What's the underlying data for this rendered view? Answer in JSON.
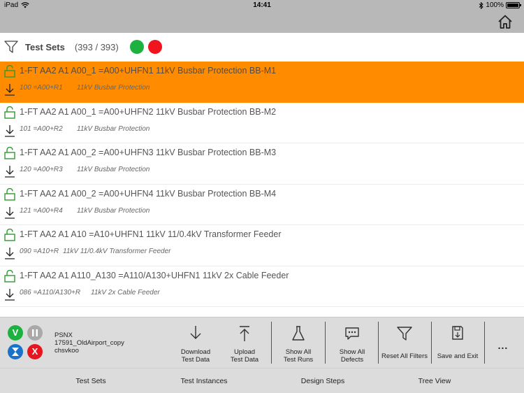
{
  "status_bar": {
    "device": "iPad",
    "time": "14:41",
    "battery": "100%"
  },
  "icons": {
    "wifi": "wifi-icon",
    "bluetooth": "bluetooth-icon",
    "battery": "battery-icon",
    "home": "home-icon",
    "filter": "filter-icon",
    "lock": "unlocked-padlock-icon",
    "download_arrow": "down-arrow-icon",
    "more": "ellipsis-icon"
  },
  "colors": {
    "selected_row": "#ff8c00",
    "bar_gray": "#b8b8b8",
    "toolbar_gray": "#dcdcdc",
    "lock_green": "#2e9a2e",
    "status_green": "#1db240",
    "status_red": "#f0141e",
    "status_blue": "#1a73c8"
  },
  "filter_bar": {
    "title": "Test Sets",
    "count": "(393 / 393)"
  },
  "test_sets": [
    {
      "title": "1-FT AA2 A1 A00_1 =A00+UHFN1 11kV Busbar Protection BB-M1",
      "code": "100 =A00+R1",
      "desc": "11kV Busbar Protection",
      "selected": true
    },
    {
      "title": "1-FT AA2 A1 A00_1 =A00+UHFN2 11kV Busbar Protection BB-M2",
      "code": "101 =A00+R2",
      "desc": "11kV Busbar Protection",
      "selected": false
    },
    {
      "title": "1-FT AA2 A1 A00_2 =A00+UHFN3 11kV Busbar Protection BB-M3",
      "code": "120 =A00+R3",
      "desc": "11kV Busbar Protection",
      "selected": false
    },
    {
      "title": "1-FT AA2 A1 A00_2 =A00+UHFN4 11kV Busbar Protection BB-M4",
      "code": "121 =A00+R4",
      "desc": "11kV Busbar Protection",
      "selected": false
    },
    {
      "title": "1-FT AA2 A1 A10 =A10+UHFN1 11kV 11/0.4kV Transformer Feeder",
      "code": "090 =A10+R",
      "desc": "11kV 11/0.4kV Transformer Feeder",
      "selected": false
    },
    {
      "title": "1-FT AA2 A1 A110_A130 =A110/A130+UHFN1 11kV 2x Cable Feeder",
      "code": "086 =A110/A130+R",
      "desc": "11kV 2x Cable Feeder",
      "selected": false
    }
  ],
  "status_icons": {
    "v": "V",
    "x": "X"
  },
  "project": {
    "line1": "PSNX",
    "line2": "17591_OldAirport_copy",
    "line3": "chsvkoo"
  },
  "toolbar": {
    "download": "Download\nTest Data",
    "upload": "Upload\nTest Data",
    "show_runs": "Show All\nTest Runs",
    "show_defects": "Show All\nDefects",
    "reset_filters": "Reset All Filters",
    "save_exit": "Save and Exit",
    "more": "..."
  },
  "tabs": [
    "Test Sets",
    "Test Instances",
    "Design Steps",
    "Tree View"
  ]
}
